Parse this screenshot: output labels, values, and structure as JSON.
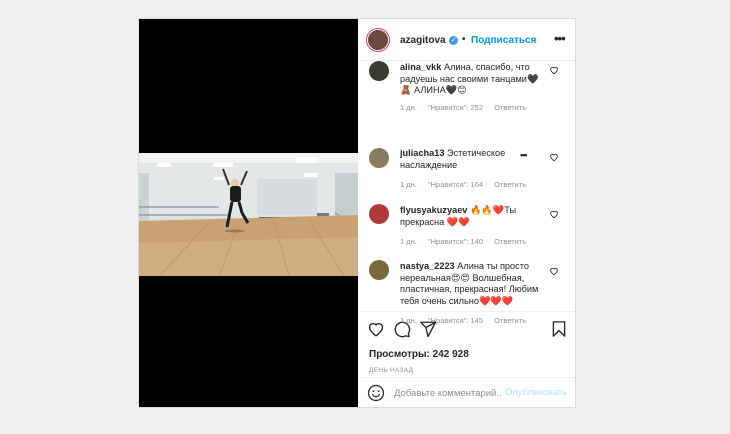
{
  "post": {
    "username": "azagitova",
    "follow_label": "Подписаться",
    "separator": "•"
  },
  "comments": [
    {
      "username": "alina_vkk",
      "text": " Алина, спасибо, что радуешь нас своими танцами🖤🧸 АЛИНА🖤😊",
      "age": "1 дн.",
      "likes": "\"Нравится\": 252",
      "reply": "Ответить",
      "avatar_color": "#3a3a2e"
    },
    {
      "username": "juliacha13",
      "text": " Эстетическое наслаждение",
      "age": "1 дн.",
      "likes": "\"Нравится\": 164",
      "reply": "Ответить",
      "avatar_color": "#8a7a5e"
    },
    {
      "username": "flyusyakuzyaev",
      "text": " 🔥🔥❤️Ты прекрасна ❤️❤️",
      "age": "1 дн.",
      "likes": "\"Нравится\": 140",
      "reply": "Ответить",
      "avatar_color": "#b03a3a"
    },
    {
      "username": "nastya_2223",
      "text": " Алина ты просто нереальная😍😍 Волшебная, пластичная, прекрасная! Любим тебя очень сильно❤️❤️❤️",
      "age": "1 дн.",
      "likes": "\"Нравится\": 145",
      "reply": "Ответить",
      "avatar_color": "#7a6a3a"
    }
  ],
  "stats": {
    "views": "Просмотры: 242 928",
    "timestamp": "ДЕНЬ НАЗАД"
  },
  "add_comment": {
    "placeholder": "Добавьте комментарий...",
    "publish_label": "Опубликовать"
  }
}
